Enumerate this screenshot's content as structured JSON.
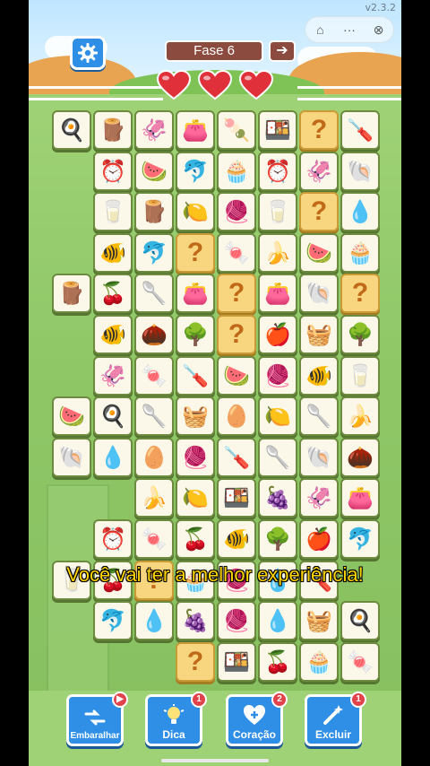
{
  "app": {
    "version": "v2.3.2"
  },
  "header": {
    "level_label": "Fase 6",
    "next_arrow": "➔",
    "hearts_count": 3,
    "heart_color": "#e0303a"
  },
  "capsule": {
    "home_icon": "⌂",
    "menu_icon": "···",
    "close_icon": "⊗"
  },
  "banner": {
    "text": "Você vai ter a melhor experiência!"
  },
  "powerups": [
    {
      "label": "Embaralhar",
      "badge": "▶",
      "icon": "shuffle-icon"
    },
    {
      "label": "Dica",
      "badge": "1",
      "icon": "bulb-icon"
    },
    {
      "label": "Coração",
      "badge": "2",
      "icon": "heart-plus-icon"
    },
    {
      "label": "Excluir",
      "badge": "1",
      "icon": "magic-wand-icon"
    }
  ],
  "tiles_legend": {
    "?": "mystery",
    "pan": "🍳",
    "log": "🪵",
    "squid": "🦑",
    "bag": "👛",
    "popsicle": "🍡",
    "lunchbox": "🍱",
    "screwdriver": "🪛",
    "clock": "⏰",
    "melon": "🍉",
    "dolphin": "🐬",
    "cupcake": "🧁",
    "shell": "🐚",
    "cup": "🥛",
    "lemon": "🍋",
    "yarn": "🧶",
    "drop": "💧",
    "fish": "🐠",
    "candy": "🍬",
    "banana": "🍌",
    "cherry": "🍒",
    "spoon": "🥄",
    "tree": "🌳",
    "apple": "🍎",
    "basket": "🧺",
    "egg": "🥚",
    "sack": "🌰",
    "grapes": "🍇"
  },
  "tiles": [
    [
      "pan",
      "log",
      "squid",
      "bag",
      "popsicle",
      "lunchbox",
      "?",
      "screwdriver"
    ],
    [
      null,
      "clock",
      "melon",
      "dolphin",
      "cupcake",
      "clock",
      "squid",
      "shell"
    ],
    [
      null,
      "cup",
      "log",
      "lemon",
      "yarn",
      "cup",
      "?",
      "drop"
    ],
    [
      null,
      "fish",
      "dolphin",
      "?",
      "candy",
      "banana",
      "melon",
      "cupcake"
    ],
    [
      "log",
      "cherry",
      "spoon",
      "bag",
      "?",
      "bag",
      "shell",
      "?"
    ],
    [
      null,
      "fish",
      "sack",
      "tree",
      "?",
      "apple",
      "basket",
      "tree"
    ],
    [
      null,
      "squid",
      "candy",
      "screwdriver",
      "melon",
      "yarn",
      "fish",
      "cup"
    ],
    [
      "melon",
      "pan",
      "spoon",
      "basket",
      "egg",
      "lemon",
      "spoon",
      "banana"
    ],
    [
      "shell",
      "drop",
      "egg",
      "yarn",
      "screwdriver",
      "spoon",
      "shell",
      "sack"
    ],
    [
      null,
      null,
      "banana",
      "lemon",
      "lunchbox",
      "grapes",
      "squid",
      "bag"
    ],
    [
      null,
      "clock",
      "candy",
      "cherry",
      "fish",
      "tree",
      "apple",
      "dolphin"
    ],
    [
      "cup",
      "cherry",
      "?",
      "cupcake",
      "yarn",
      "drop",
      "screwdriver",
      null
    ],
    [
      null,
      "dolphin",
      "drop",
      "grapes",
      "yarn",
      "drop",
      "basket",
      "pan"
    ],
    [
      null,
      null,
      null,
      "?",
      "lunchbox",
      "cherry",
      "cupcake",
      "candy"
    ]
  ]
}
